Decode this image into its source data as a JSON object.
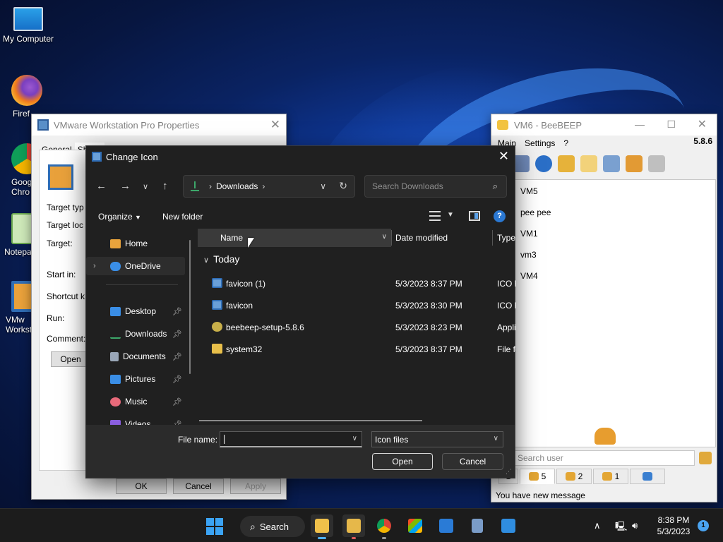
{
  "desktop": {
    "icons": [
      {
        "label": "My Computer"
      },
      {
        "label": "Firef"
      },
      {
        "label": "Goog\nChro"
      },
      {
        "label": "Notepa"
      },
      {
        "label": "VMw\nWorkst"
      }
    ]
  },
  "vmware_props": {
    "title": "VMware Workstation Pro Properties",
    "tabs": [
      "General",
      "Shortc"
    ],
    "labels": [
      "Target typ",
      "Target loc",
      "Target:",
      "Start in:",
      "Shortcut k",
      "Run:",
      "Comment:"
    ],
    "open_button": "Open",
    "ok": "OK",
    "cancel": "Cancel",
    "apply": "Apply"
  },
  "beebeep": {
    "title": "VM6 - BeeBEEP",
    "menu": [
      "Main",
      "Settings",
      "?"
    ],
    "version": "5.8.6",
    "users": [
      "VM5",
      "pee pee",
      "VM1",
      "vm3",
      "VM4"
    ],
    "search_placeholder": "Search user",
    "tabs": [
      {
        "label": "1"
      },
      {
        "label": "5"
      },
      {
        "label": "2"
      },
      {
        "label": "1"
      },
      {
        "label": ""
      }
    ],
    "status": "You have new message"
  },
  "dialog": {
    "title": "Change Icon",
    "breadcrumb": [
      "Downloads"
    ],
    "search_placeholder": "Search Downloads",
    "organize": "Organize",
    "new_folder": "New folder",
    "nav_items": [
      {
        "label": "Home",
        "icon": "home-icon",
        "color": "#e8a33c"
      },
      {
        "label": "OneDrive",
        "icon": "cloud-icon",
        "color": "#3a8ee6"
      },
      {
        "label": "Desktop",
        "icon": "desktop-icon",
        "color": "#3a8ee6"
      },
      {
        "label": "Downloads",
        "icon": "download-icon",
        "color": "#3da86a"
      },
      {
        "label": "Documents",
        "icon": "document-icon",
        "color": "#9aa7b8"
      },
      {
        "label": "Pictures",
        "icon": "pictures-icon",
        "color": "#3a8ee6"
      },
      {
        "label": "Music",
        "icon": "music-icon",
        "color": "#e86a7a"
      },
      {
        "label": "Videos",
        "icon": "videos-icon",
        "color": "#8a5ee0"
      }
    ],
    "columns": {
      "name": "Name",
      "date": "Date modified",
      "type": "Type"
    },
    "group": "Today",
    "files": [
      {
        "name": "favicon (1)",
        "date": "5/3/2023 8:37 PM",
        "type": "ICO F",
        "icon": "ico-file-icon",
        "color": "#6aa0d8"
      },
      {
        "name": "favicon",
        "date": "5/3/2023 8:30 PM",
        "type": "ICO F",
        "icon": "ico-file-icon",
        "color": "#6aa0d8"
      },
      {
        "name": "beebeep-setup-5.8.6",
        "date": "5/3/2023 8:23 PM",
        "type": "Appli",
        "icon": "installer-icon",
        "color": "#c9b04a"
      },
      {
        "name": "system32",
        "date": "5/3/2023 8:37 PM",
        "type": "File fo",
        "icon": "folder-icon",
        "color": "#e8bf4a"
      }
    ],
    "file_name_label": "File name:",
    "file_name_value": "",
    "file_type": "Icon files",
    "open": "Open",
    "cancel": "Cancel"
  },
  "taskbar": {
    "search_label": "Search",
    "time": "8:38 PM",
    "date": "5/3/2023",
    "notification_count": "1"
  }
}
